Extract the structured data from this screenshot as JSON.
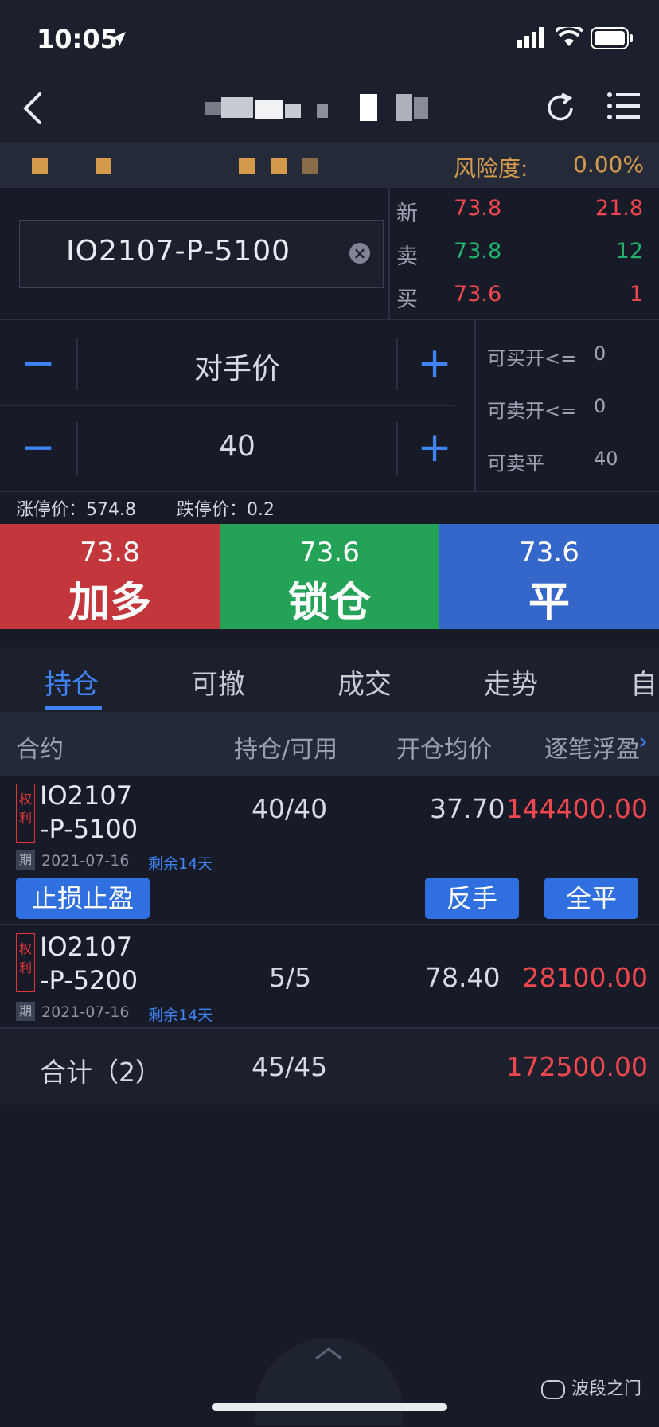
{
  "status": {
    "time": "10:05"
  },
  "risk": {
    "label": "风险度:",
    "value": "0.00%"
  },
  "quote": {
    "symbol": "IO2107-P-5100",
    "rows": [
      {
        "label": "新",
        "price": "73.8",
        "value": "21.8"
      },
      {
        "label": "卖",
        "price": "73.8",
        "value": "12"
      },
      {
        "label": "买",
        "price": "73.6",
        "value": "1"
      }
    ]
  },
  "order": {
    "price_type": "对手价",
    "quantity": "40",
    "avail": [
      {
        "label": "可买开<=",
        "value": "0"
      },
      {
        "label": "可卖开<=",
        "value": "0"
      },
      {
        "label": "可卖平",
        "value": "40"
      }
    ],
    "limit_up": "涨停价：574.8",
    "limit_down": "跌停价：0.2"
  },
  "actions": [
    {
      "price": "73.8",
      "label": "加多",
      "color": "#c2363c"
    },
    {
      "price": "73.6",
      "label": "锁仓",
      "color": "#24a358"
    },
    {
      "price": "73.6",
      "label": "平",
      "color": "#3566c9"
    }
  ],
  "tabs": [
    "持仓",
    "可撤",
    "成交",
    "走势",
    "自"
  ],
  "columns": {
    "contract": "合约",
    "hold": "持仓/可用",
    "avg": "开仓均价",
    "pl": "逐笔浮盈"
  },
  "positions": [
    {
      "tag1": "权",
      "tag2": "利",
      "line1": "IO2107",
      "line2": "-P-5100",
      "qi": "期",
      "date": "2021-07-16",
      "remain": "剩余14天",
      "hold": "40/40",
      "avg": "37.70",
      "pl": "144400.00",
      "buttons": {
        "stop": "止损止盈",
        "reverse": "反手",
        "close_all": "全平"
      }
    },
    {
      "tag1": "权",
      "tag2": "利",
      "line1": "IO2107",
      "line2": "-P-5200",
      "qi": "期",
      "date": "2021-07-16",
      "remain": "剩余14天",
      "hold": "5/5",
      "avg": "78.40",
      "pl": "28100.00"
    }
  ],
  "total": {
    "label": "合计（2）",
    "hold": "45/45",
    "pl": "172500.00"
  },
  "watermark": "波段之门"
}
